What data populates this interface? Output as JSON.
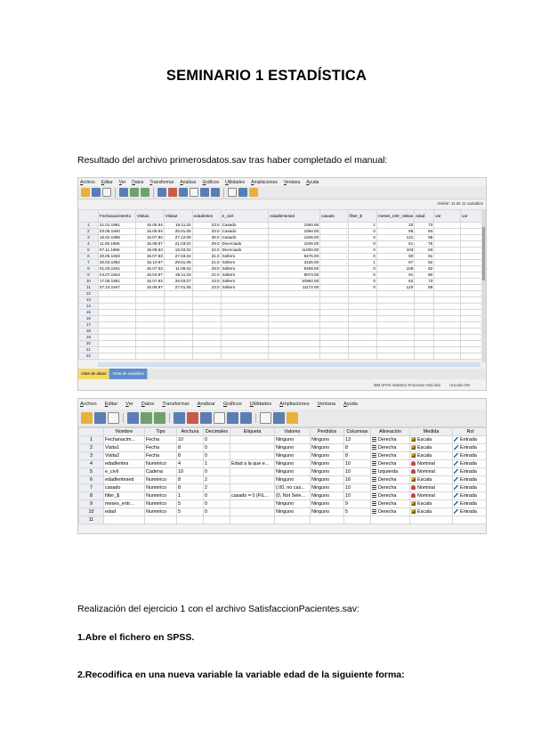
{
  "title": "SEMINARIO 1 ESTADÍSTICA",
  "paragraph1": "Resultado del archivo primerosdatos.sav tras haber completado el manual:",
  "paragraph2": "Realización del ejercicio 1 con el archivo SatisfaccionPacientes.sav:",
  "step1": "1.Abre el fichero en SPSS.",
  "step2": "2.Recodifica en una nueva variable la variable edad de la siguiente forma:",
  "data_view": {
    "menu": [
      "Archivo",
      "Editar",
      "Ver",
      "Datos",
      "Transformar",
      "Analizar",
      "Gráficos",
      "Utilidades",
      "Ampliaciones",
      "Ventana",
      "Ayuda"
    ],
    "visible_label": "Visible: 11 de 11 variables",
    "columns": [
      "FechanacimIento",
      "Visita1",
      "Visita2",
      "edadentes",
      "e_civil",
      "edadlentesed",
      "casado",
      "filter_$",
      "meses_entr_visitas",
      "edad",
      "var",
      "var"
    ],
    "rows": [
      [
        "1",
        "21.01.1961",
        "15.05.94",
        "16.11.02",
        "23.0",
        "Casado",
        "1000.00",
        ".",
        "1",
        "33",
        "73"
      ],
      [
        "2",
        "03.08.1940",
        "15.06.94",
        "20.01.05",
        "33.0",
        "Casado",
        "1094.00",
        ".",
        "0",
        "95",
        "84"
      ],
      [
        "3",
        "16.02.1966",
        "15.07.94",
        "27.12.05",
        "35.0",
        "Casado",
        "1346.00",
        ".",
        "0",
        "131",
        "58"
      ],
      [
        "4",
        "11.05.1966",
        "15.08.97",
        "21.03.02",
        "29.0",
        "Divorciado",
        "1026.00",
        ".",
        "0",
        "61",
        "75"
      ],
      [
        "5",
        "07.11.1966",
        "15.09.93",
        "15.03.02",
        "22.0",
        "Divorciado",
        "11000.00",
        ".",
        "0",
        "103",
        "63"
      ],
      [
        "6",
        "20.05.1933",
        "15.07.93",
        "27.03.02",
        "31.0",
        "Soltero",
        "6475.00",
        ".",
        "0",
        "80",
        "91"
      ],
      [
        "7",
        "30.03.1962",
        "15.10.97",
        "29.01.05",
        "21.0",
        "Soltero",
        "3125.00",
        ".",
        "1",
        "87",
        "62"
      ],
      [
        "8",
        "01.03.1941",
        "15.07.93",
        "11.09.02",
        "29.0",
        "Soltero",
        "5408.00",
        ".",
        "0",
        "109",
        "82"
      ],
      [
        "9",
        "04.07.1944",
        "15.04.97",
        "26.11.03",
        "21.0",
        "Soltero",
        "8074.00",
        ".",
        "0",
        "91",
        "80"
      ],
      [
        "10",
        "17.05.1951",
        "15.07.93",
        "26.03.07",
        "43.0",
        "Soltero",
        "10964.00",
        ".",
        "0",
        "62",
        "73"
      ],
      [
        "11",
        "07.10.1947",
        "15.06.97",
        "27.01.05",
        "23.0",
        "Soltero",
        "11172.00",
        ".",
        "0",
        "120",
        "58"
      ]
    ],
    "empty_rows": [
      "12",
      "13",
      "14",
      "15",
      "16",
      "17",
      "18",
      "19",
      "20",
      "21",
      "22"
    ],
    "tab_data": "Vista de datos",
    "tab_vars": "Vista de variables",
    "status_processor": "IBM SPSS Statistics Processor está listo",
    "status_unicode": "Unicode:ON"
  },
  "var_view": {
    "menu": [
      "Archivo",
      "Editar",
      "Ver",
      "Datos",
      "Transformar",
      "Analizar",
      "Gráficos",
      "Utilidades",
      "Ampliaciones",
      "Ventana",
      "Ayuda"
    ],
    "headers": [
      "",
      "Nombre",
      "Tipo",
      "Anchura",
      "Decimales",
      "Etiqueta",
      "Valores",
      "Perdidos",
      "Columnas",
      "Alineación",
      "Medida",
      "Rol"
    ],
    "rows": [
      [
        "1",
        "Fechanacim...",
        "Fecha",
        "10",
        "0",
        "",
        "Ninguno",
        "Ninguno",
        "13",
        "Derecha",
        "Escala",
        "Entrada"
      ],
      [
        "2",
        "Visita1",
        "Fecha",
        "8",
        "0",
        "",
        "Ninguno",
        "Ninguno",
        "8",
        "Derecha",
        "Escala",
        "Entrada"
      ],
      [
        "3",
        "Visita2",
        "Fecha",
        "8",
        "0",
        "",
        "Ninguno",
        "Ninguno",
        "8",
        "Derecha",
        "Escala",
        "Entrada"
      ],
      [
        "4",
        "edadlentes",
        "Numérico",
        "4",
        "1",
        "Edad a la que e...",
        "Ninguno",
        "Ninguno",
        "10",
        "Derecha",
        "Nominal",
        "Entrada"
      ],
      [
        "5",
        "e_civil",
        "Cadena",
        "10",
        "0",
        "",
        "Ninguno",
        "Ninguno",
        "10",
        "Izquierda",
        "Nominal",
        "Entrada"
      ],
      [
        "6",
        "edadlentesed",
        "Numérico",
        "8",
        "2",
        "",
        "Ninguno",
        "Ninguno",
        "16",
        "Derecha",
        "Escala",
        "Entrada"
      ],
      [
        "7",
        "casado",
        "Numérico",
        "8",
        "2",
        "",
        "{.00, no cas...",
        "Ninguno",
        "10",
        "Derecha",
        "Nominal",
        "Entrada"
      ],
      [
        "8",
        "filter_$",
        "Numérico",
        "1",
        "0",
        "casado = 0 (FIL...",
        "{0, Not Sele...",
        "Ninguno",
        "10",
        "Derecha",
        "Nominal",
        "Entrada"
      ],
      [
        "9",
        "meses_entr...",
        "Numérico",
        "5",
        "0",
        "",
        "Ninguno",
        "Ninguno",
        "9",
        "Derecha",
        "Escala",
        "Entrada"
      ],
      [
        "10",
        "edad",
        "Numérico",
        "5",
        "0",
        "",
        "Ninguno",
        "Ninguno",
        "5",
        "Derecha",
        "Escala",
        "Entrada"
      ]
    ],
    "empty_rows": [
      "11"
    ]
  }
}
